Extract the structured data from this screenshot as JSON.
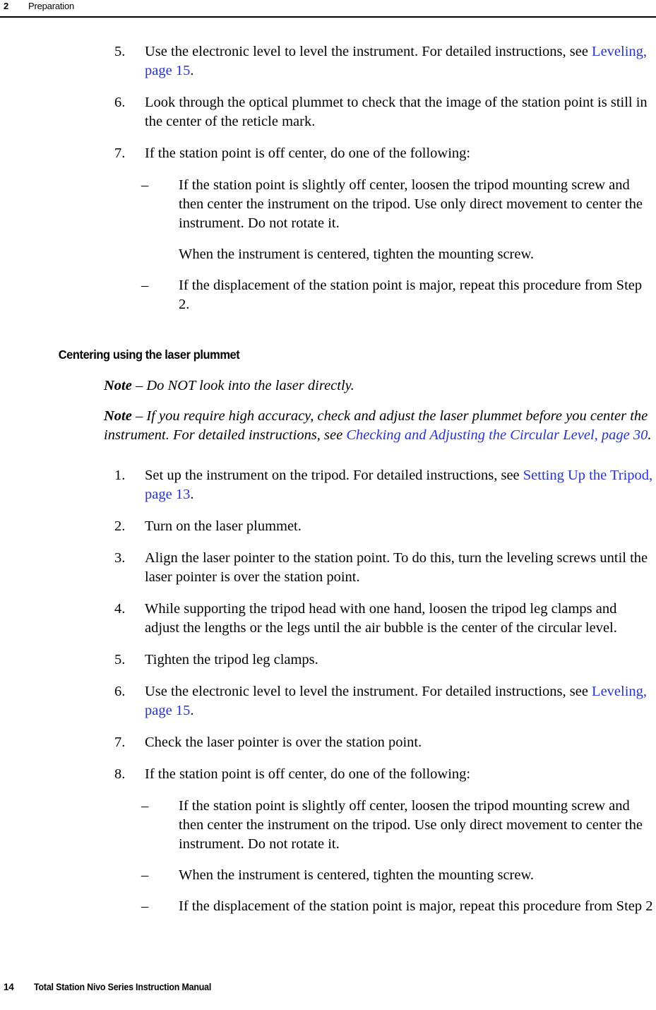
{
  "header": {
    "chapter_number": "2",
    "chapter_title": "Preparation"
  },
  "footer": {
    "page_number": "14",
    "document_title": "Total Station Nivo Series Instruction Manual"
  },
  "colors": {
    "link": "#2733cc",
    "text": "#000000",
    "rule": "#000000"
  },
  "top_list": {
    "items": [
      {
        "marker": "5.",
        "text_before_link": "Use the electronic level to level the instrument. For detailed instructions, see ",
        "link": "Leveling, page 15",
        "text_after_link": "."
      },
      {
        "marker": "6.",
        "text": "Look through the optical plummet to check that the image of the station point is still in the center of the reticle mark."
      },
      {
        "marker": "7.",
        "text": "If the station point is off center, do one of the following:"
      }
    ],
    "sub_items": [
      {
        "dash": "–",
        "text": "If the station point is slightly off center, loosen the tripod mounting screw and then center the instrument on the tripod. Use only direct movement to center the instrument. Do not rotate it."
      },
      {
        "dash": "",
        "text": "When the instrument is centered, tighten the mounting screw."
      },
      {
        "dash": "–",
        "text": "If the displacement of the station point is major, repeat this procedure from Step 2."
      }
    ]
  },
  "section": {
    "heading": "Centering using the laser plummet",
    "notes": [
      {
        "label": "Note",
        "separator": " – ",
        "text": "Do NOT look into the laser directly."
      },
      {
        "label": "Note",
        "separator": " – ",
        "text_before_link": "If you require high accuracy, check and adjust the laser plummet before you center the instrument. For detailed instructions, see ",
        "link": "Checking and Adjusting the Circular Level, page 30",
        "text_after_link": "."
      }
    ]
  },
  "main_list": {
    "items": [
      {
        "marker": "1.",
        "text_before_link": "Set up the instrument on the tripod. For detailed instructions, see ",
        "link": "Setting Up the Tripod, page 13",
        "text_after_link": "."
      },
      {
        "marker": "2.",
        "text": "Turn on the laser plummet."
      },
      {
        "marker": "3.",
        "text": "Align the laser pointer to the station point. To do this, turn the leveling screws until the laser pointer is over the station point."
      },
      {
        "marker": "4.",
        "text": "While supporting the tripod head with one hand, loosen the tripod leg clamps and adjust the lengths or the legs until the air bubble is the center of the circular level."
      },
      {
        "marker": "5.",
        "text": "Tighten the tripod leg clamps."
      },
      {
        "marker": "6.",
        "text_before_link": "Use the electronic level to level the instrument. For detailed instructions, see ",
        "link": "Leveling, page 15",
        "text_after_link": "."
      },
      {
        "marker": "7.",
        "text": "Check the laser pointer is over the station point."
      },
      {
        "marker": "8.",
        "text": "If the station point is off center, do one of the following:"
      }
    ],
    "sub_items": [
      {
        "dash": "–",
        "text": "If the station point is slightly off center, loosen the tripod mounting screw and then center the instrument on the tripod. Use only direct movement to center the instrument. Do not rotate it."
      },
      {
        "dash": "–",
        "text": "When the instrument is centered, tighten the mounting screw."
      },
      {
        "dash": "–",
        "text": "If the displacement of the station point is major, repeat this procedure from Step 2"
      }
    ]
  }
}
